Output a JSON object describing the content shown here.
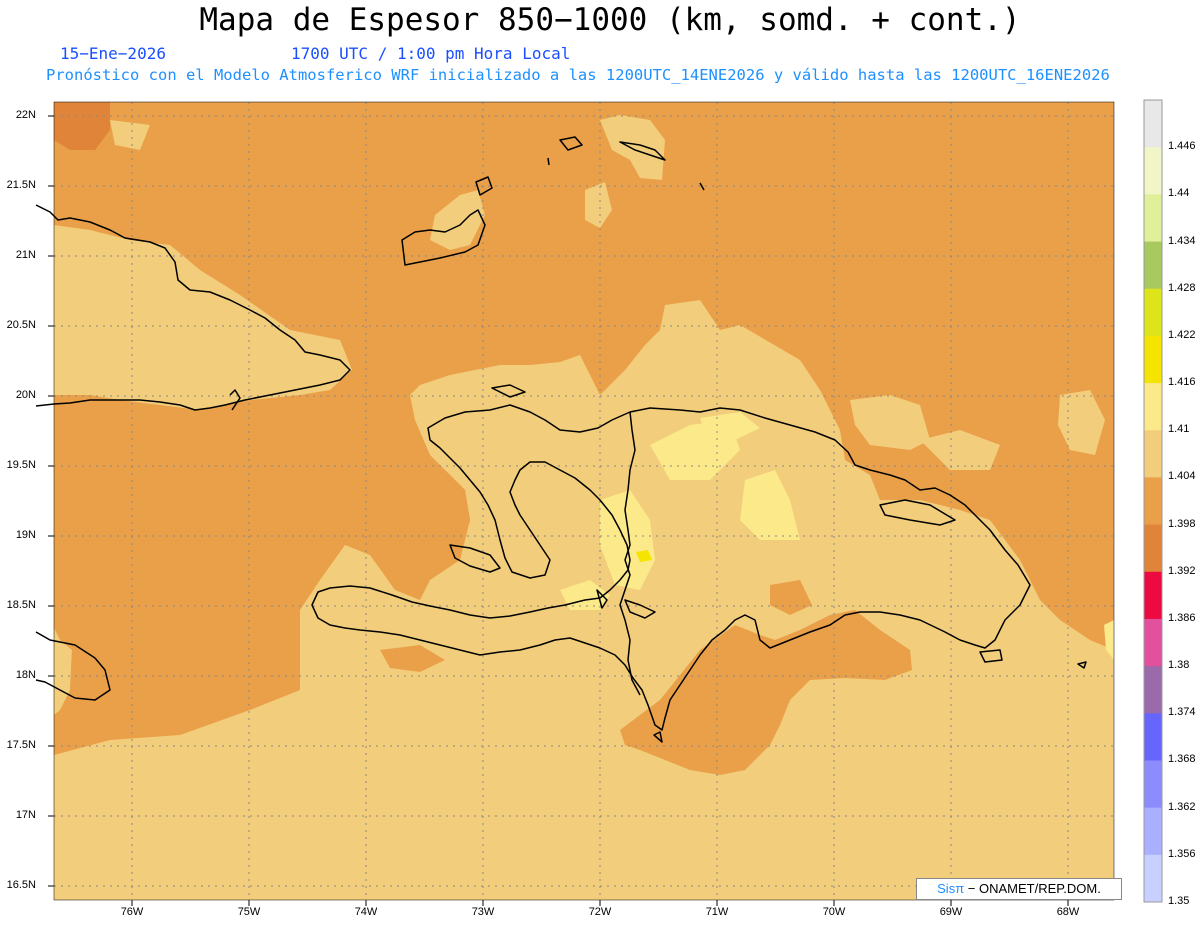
{
  "header": {
    "title": "Mapa de Espesor 850−1000 (km, somd. + cont.)",
    "date": "15−Ene−2026",
    "time": "1700 UTC / 1:00 pm Hora Local",
    "model_line": "Pronóstico con el Modelo Atmosferico WRF inicializado a las 1200UTC_14ENE2026 y válido hasta las  1200UTC_16ENE2026"
  },
  "axes": {
    "lat_labels": [
      "22N",
      "21.5N",
      "21N",
      "20.5N",
      "20N",
      "19.5N",
      "19N",
      "18.5N",
      "18N",
      "17.5N",
      "17N",
      "16.5N"
    ],
    "lon_labels": [
      "76W",
      "75W",
      "74W",
      "73W",
      "72W",
      "71W",
      "70W",
      "69W",
      "68W"
    ]
  },
  "colorbar": {
    "labels": [
      "1.446",
      "1.44",
      "1.434",
      "1.428",
      "1.422",
      "1.416",
      "1.41",
      "1.404",
      "1.398",
      "1.392",
      "1.386",
      "1.38",
      "1.374",
      "1.368",
      "1.362",
      "1.356",
      "1.35"
    ],
    "colors": [
      "#e8e8e8",
      "#f2f5c8",
      "#e0f09a",
      "#a8c860",
      "#dde51a",
      "#f5e400",
      "#fbe98a",
      "#f2cd7c",
      "#e9a048",
      "#df8439",
      "#ec0a40",
      "#e2509e",
      "#9a6aaa",
      "#6666ff",
      "#8c8cff",
      "#a8b0ff",
      "#c8d0ff"
    ]
  },
  "map_colors": {
    "orange": "#e9a048",
    "tan": "#f2cd7c",
    "yellow": "#fbe98a",
    "bright_yellow": "#f5e400",
    "dark_orange": "#df8439"
  },
  "credit": {
    "brand": "Sisπ",
    "text": "− ONAMET/REP.DOM."
  }
}
